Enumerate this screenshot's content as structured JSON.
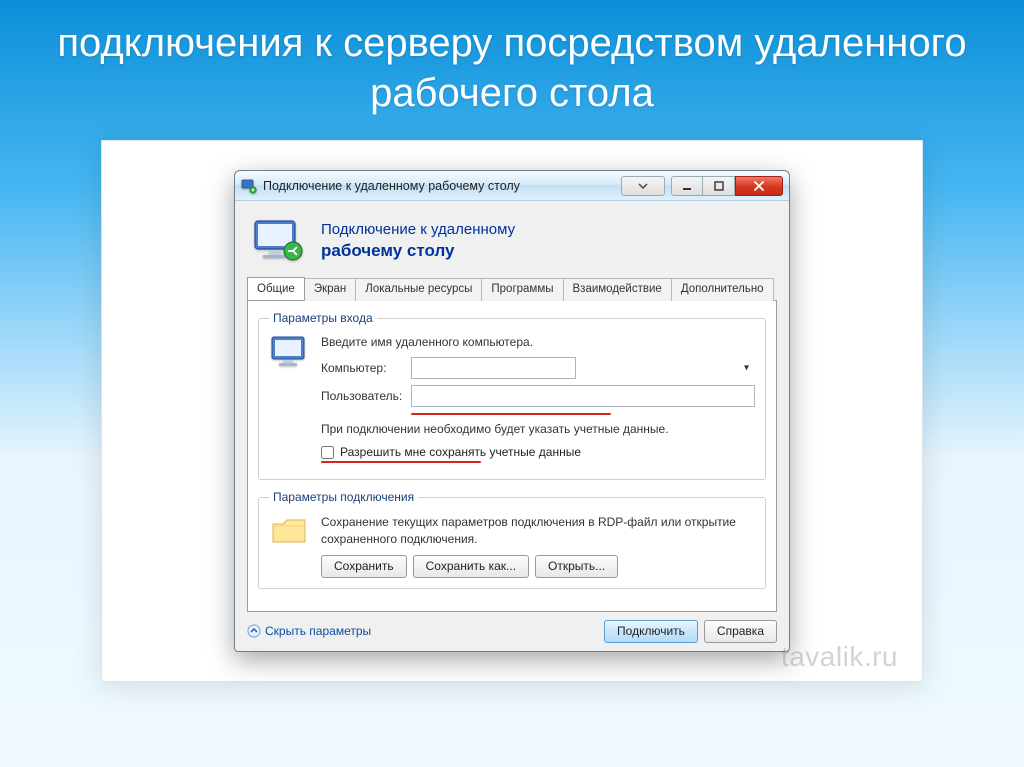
{
  "slide": {
    "title": "подключения к серверу посредством удаленного рабочего стола",
    "watermark": "tavalik.ru"
  },
  "window": {
    "title": "Подключение к удаленному рабочему столу",
    "banner": {
      "line1": "Подключение к удаленному",
      "line2": "рабочему столу"
    },
    "tabs": {
      "general": "Общие",
      "display": "Экран",
      "local_resources": "Локальные ресурсы",
      "programs": "Программы",
      "experience": "Взаимодействие",
      "advanced": "Дополнительно"
    },
    "login_group": {
      "legend": "Параметры входа",
      "hint": "Введите имя удаленного компьютера.",
      "computer_label": "Компьютер:",
      "computer_value": "",
      "user_label": "Пользователь:",
      "user_value": "",
      "note": "При подключении необходимо будет указать учетные данные.",
      "save_creds": "Разрешить мне сохранять учетные данные"
    },
    "conn_group": {
      "legend": "Параметры подключения",
      "desc": "Сохранение текущих параметров подключения в RDP-файл или открытие сохраненного подключения.",
      "save": "Сохранить",
      "save_as": "Сохранить как...",
      "open": "Открыть..."
    },
    "footer": {
      "hide_params": "Скрыть параметры",
      "connect": "Подключить",
      "help": "Справка"
    }
  }
}
